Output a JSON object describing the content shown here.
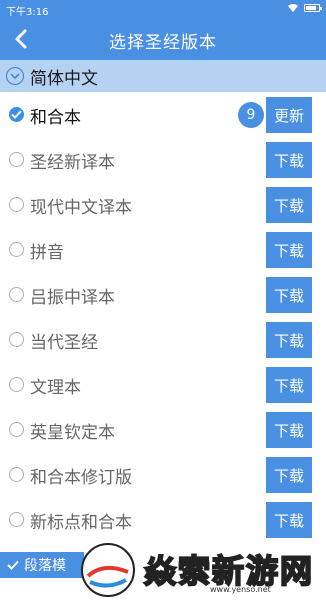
{
  "status": {
    "time": "下午3:16"
  },
  "header": {
    "title": "选择圣经版本"
  },
  "group": {
    "title": "简体中文"
  },
  "versions": [
    {
      "name": "和合本",
      "selected": true,
      "badge": "9",
      "action": "更新"
    },
    {
      "name": "圣经新译本",
      "selected": false,
      "action": "下载"
    },
    {
      "name": "现代中文译本",
      "selected": false,
      "action": "下载"
    },
    {
      "name": "拼音",
      "selected": false,
      "action": "下载"
    },
    {
      "name": "吕振中译本",
      "selected": false,
      "action": "下载"
    },
    {
      "name": "当代圣经",
      "selected": false,
      "action": "下载"
    },
    {
      "name": "文理本",
      "selected": false,
      "action": "下载"
    },
    {
      "name": "英皇钦定本",
      "selected": false,
      "action": "下载"
    },
    {
      "name": "和合本修订版",
      "selected": false,
      "action": "下载"
    },
    {
      "name": "新标点和合本",
      "selected": false,
      "action": "下载"
    }
  ],
  "footer": {
    "option_label": "段落模"
  },
  "watermark": {
    "text": "焱索新游网",
    "url": "www.yenso.net"
  },
  "colors": {
    "primary": "#4a90e2",
    "group_bg": "#b5d2f3"
  }
}
